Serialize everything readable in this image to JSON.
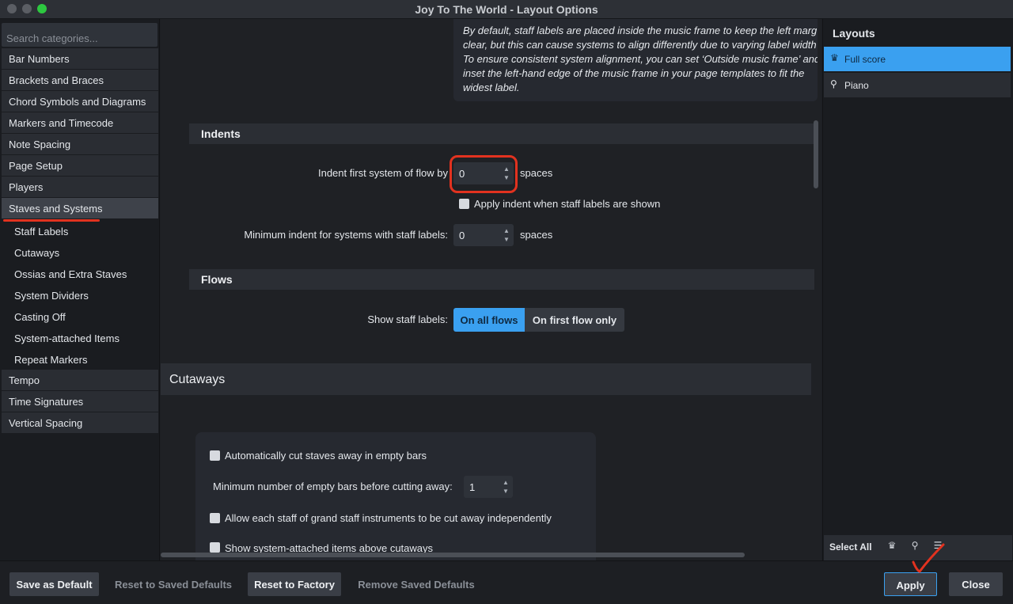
{
  "window": {
    "title": "Joy To The World - Layout Options"
  },
  "sidebar": {
    "search_placeholder": "Search categories...",
    "categories": [
      "Bar Numbers",
      "Brackets and Braces",
      "Chord Symbols and Diagrams",
      "Markers and Timecode",
      "Note Spacing",
      "Page Setup",
      "Players",
      "Staves and Systems"
    ],
    "subcategories": [
      "Staff Labels",
      "Cutaways",
      "Ossias and Extra Staves",
      "System Dividers",
      "Casting Off",
      "System-attached Items",
      "Repeat Markers"
    ],
    "categories_after": [
      "Tempo",
      "Time Signatures",
      "Vertical Spacing"
    ],
    "active": "Staves and Systems"
  },
  "main": {
    "info_lines": [
      "By default, staff labels are placed inside the music frame to keep the left marg",
      "clear, but this can cause systems to align differently due to varying label width",
      "To ensure consistent system alignment, you can set ‘Outside music frame’ and",
      "inset the left-hand edge of the music frame in your page templates to fit the",
      "widest label."
    ],
    "indents": {
      "heading": "Indents",
      "first_label": "Indent first system of flow by",
      "first_value": "0",
      "unit": "spaces",
      "apply_indent_label": "Apply indent when staff labels are shown",
      "min_label": "Minimum indent for systems with staff labels:",
      "min_value": "0"
    },
    "flows": {
      "heading": "Flows",
      "show_label": "Show staff labels:",
      "option_all": "On all flows",
      "option_first": "On first flow only"
    },
    "cutaways": {
      "heading": "Cutaways",
      "auto_cut_label": "Automatically cut staves away in empty bars",
      "min_bars_label": "Minimum number of empty bars before cutting away:",
      "min_bars_value": "1",
      "grand_staff_label": "Allow each staff of grand staff instruments to be cut away independently",
      "show_items_label": "Show system-attached items above cutaways"
    }
  },
  "layouts": {
    "heading": "Layouts",
    "items": [
      {
        "label": "Full score",
        "selected": true
      },
      {
        "label": "Piano",
        "selected": false
      }
    ],
    "select_all": "Select All"
  },
  "footer": {
    "save_default": "Save as Default",
    "reset_saved": "Reset to Saved Defaults",
    "reset_factory": "Reset to Factory",
    "remove_saved": "Remove Saved Defaults",
    "apply": "Apply",
    "close": "Close"
  },
  "colors": {
    "accent": "#3aa0f0",
    "annotation_red": "#e2321f"
  }
}
